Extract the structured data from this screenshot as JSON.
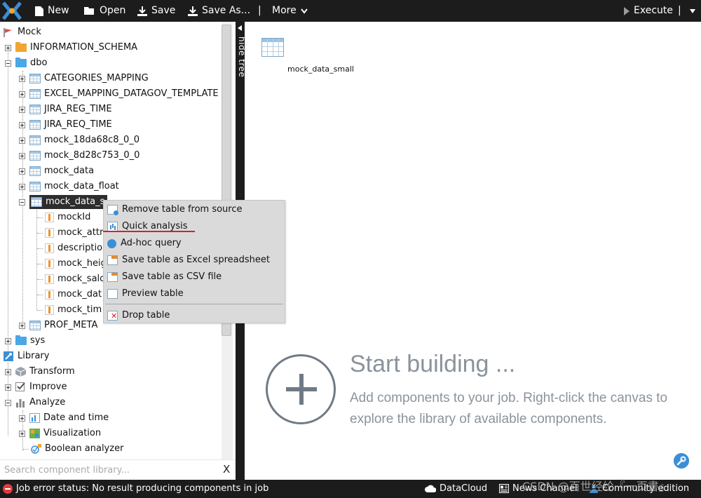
{
  "toolbar": {
    "new_label": "New",
    "open_label": "Open",
    "save_label": "Save",
    "save_as_label": "Save As...",
    "separator": "|",
    "more_label": "More",
    "execute_label": "Execute",
    "execute_separator": "|"
  },
  "tree": {
    "root_label": "Mock",
    "info_schema": "INFORMATION_SCHEMA",
    "dbo": "dbo",
    "tables": [
      "CATEGORIES_MAPPING",
      "EXCEL_MAPPING_DATAGOV_TEMPLATE",
      "JIRA_REG_TIME",
      "JIRA_REQ_TIME",
      "mock_18da68c8_0_0",
      "mock_8d28c753_0_0",
      "mock_data",
      "mock_data_float",
      "mock_data_s"
    ],
    "columns": [
      "mockId",
      "mock_attr",
      "descriptio",
      "mock_heig",
      "mock_salc",
      "mock_dat",
      "mock_tim"
    ],
    "prof_meta": "PROF_META",
    "sys": "sys",
    "library": "Library",
    "transform": "Transform",
    "improve": "Improve",
    "analyze": "Analyze",
    "date_time": "Date and time",
    "visualization": "Visualization",
    "boolean_analyzer": "Boolean analyzer"
  },
  "search": {
    "placeholder": "Search component library...",
    "clear": "X"
  },
  "hide_tree": "hide tree",
  "context_menu": {
    "remove": "Remove table from source",
    "quick_analysis": "Quick analysis",
    "adhoc": "Ad-hoc query",
    "save_excel": "Save table as Excel spreadsheet",
    "save_csv": "Save table as CSV file",
    "preview": "Preview table",
    "drop": "Drop table"
  },
  "canvas": {
    "node_label": "mock_data_small",
    "title": "Start building ...",
    "description": "Add components to your job. Right-click the canvas to explore the library of available components."
  },
  "status": {
    "error_text": "Job error status: No result producing components in job",
    "datacloud": "DataCloud",
    "news": "News Channel",
    "community": "Community edition",
    "watermark": "CSDN @百世经纶『一页書』"
  },
  "colors": {
    "bar_bg": "#1c1c1c",
    "accent_blue": "#3a8fd6",
    "error_red": "#e23b3b",
    "underline_red": "#d3232b"
  }
}
